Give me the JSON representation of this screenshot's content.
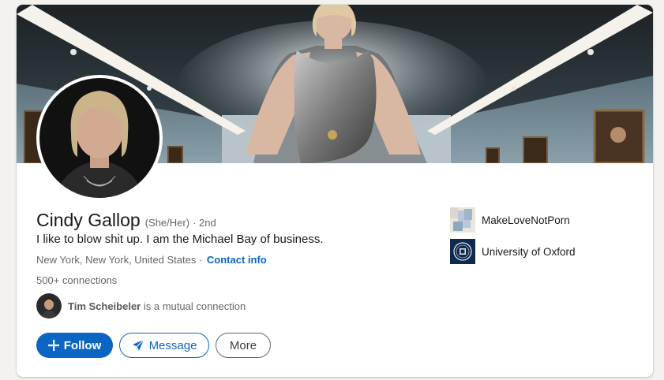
{
  "profile": {
    "name": "Cindy Gallop",
    "pronouns": "(She/Her)",
    "degree": "· 2nd",
    "headline": "I like to blow shit up. I am the Michael Bay of business.",
    "location": "New York, New York, United States ·",
    "contact_label": "Contact info",
    "connections": "500+ connections",
    "mutual_name": "Tim Scheibeler",
    "mutual_suffix": " is a mutual connection"
  },
  "actions": {
    "follow_label": "Follow",
    "message_label": "Message",
    "more_label": "More"
  },
  "companies": [
    {
      "name": "MakeLoveNotPorn",
      "icon": "company-logo-placeholder"
    },
    {
      "name": "University of Oxford",
      "icon": "oxford-crest"
    }
  ],
  "colors": {
    "primary": "#0a66c2",
    "background": "#f3f2ef",
    "text": "#191919",
    "secondary_text": "#666666"
  }
}
